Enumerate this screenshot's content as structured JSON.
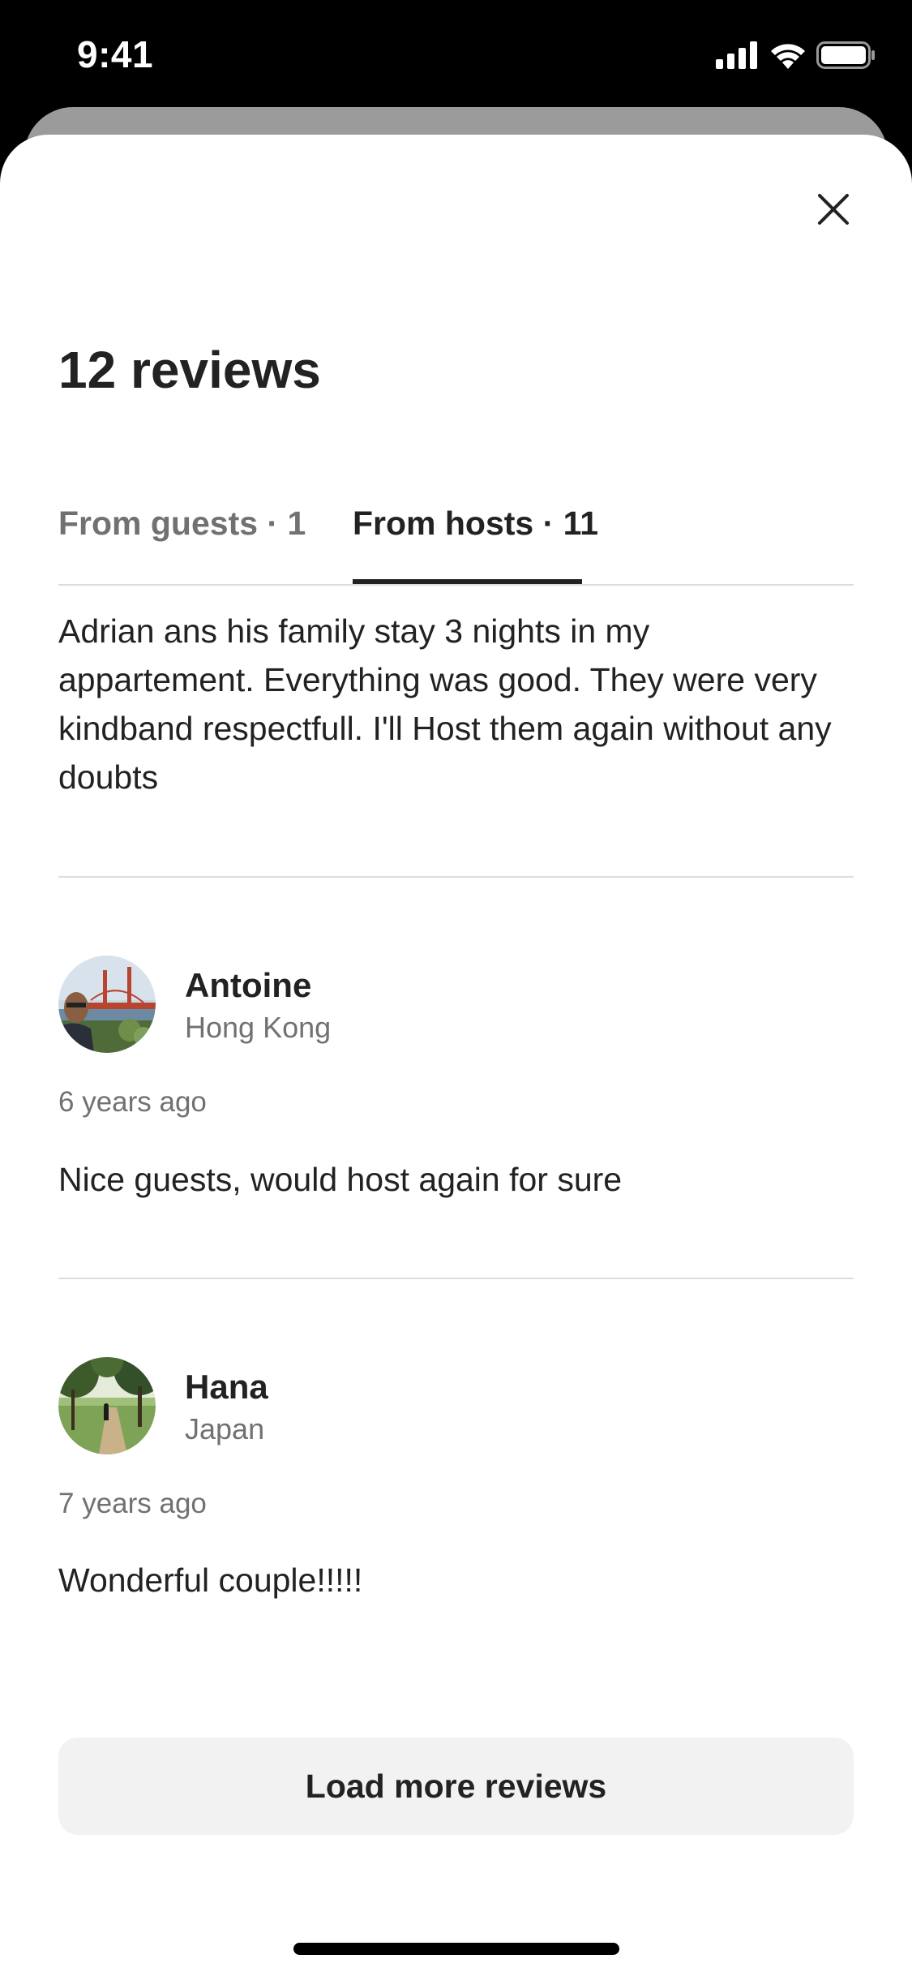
{
  "status_bar": {
    "time": "9:41",
    "icons": [
      "cellular-signal-icon",
      "wifi-icon",
      "battery-icon"
    ]
  },
  "header": {
    "close_icon": "close-icon",
    "title": "12 reviews"
  },
  "tabs": [
    {
      "label": "From guests · 1",
      "active": false
    },
    {
      "label": "From hosts · 11",
      "active": true
    }
  ],
  "reviews": [
    {
      "text": "Adrian ans his family stay 3 nights in my appartement. Everything was good. They were very kindband respectfull. I'll Host them again without any doubts"
    },
    {
      "name": "Antoine",
      "location": "Hong Kong",
      "date": "6 years ago",
      "text": "Nice guests, would host again for sure"
    },
    {
      "name": "Hana",
      "location": "Japan",
      "date": "7 years ago",
      "text": "Wonderful couple!!!!!"
    }
  ],
  "footer": {
    "load_more_label": "Load more reviews"
  },
  "colors": {
    "text_primary": "#222222",
    "text_secondary": "#717171",
    "divider": "#dddddd",
    "button_bg": "#f2f2f2"
  }
}
